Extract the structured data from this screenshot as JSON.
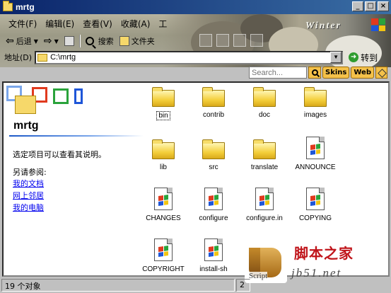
{
  "window": {
    "title": "mrtg"
  },
  "title_buttons": {
    "minimize": "_",
    "maximize": "□",
    "close": "×"
  },
  "banner": {
    "watermark_text": "Winter"
  },
  "menu": [
    "文件(F)",
    "编辑(E)",
    "查看(V)",
    "收藏(A)",
    "工"
  ],
  "toolbar": {
    "back_label": "后退",
    "search_label": "搜索",
    "folders_label": "文件夹"
  },
  "address": {
    "label": "地址(D)",
    "value": "C:\\mrtg",
    "go_label": "转到"
  },
  "search_bar": {
    "placeholder": "Search...",
    "skins_label": "Skins",
    "web_label": "Web"
  },
  "left_pane": {
    "title": "mrtg",
    "description": "选定项目可以查看其说明。",
    "see_also": "另请参阅:",
    "links": [
      "我的文档",
      "网上邻居",
      "我的电脑"
    ]
  },
  "items": [
    {
      "name": "bin",
      "type": "folder",
      "selected": true
    },
    {
      "name": "contrib",
      "type": "folder"
    },
    {
      "name": "doc",
      "type": "folder"
    },
    {
      "name": "images",
      "type": "folder"
    },
    {
      "name": "lib",
      "type": "folder"
    },
    {
      "name": "src",
      "type": "folder"
    },
    {
      "name": "translate",
      "type": "folder"
    },
    {
      "name": "ANNOUNCE",
      "type": "file"
    },
    {
      "name": "CHANGES",
      "type": "file"
    },
    {
      "name": "configure",
      "type": "file"
    },
    {
      "name": "configure.in",
      "type": "file"
    },
    {
      "name": "COPYING",
      "type": "file"
    },
    {
      "name": "COPYRIGHT",
      "type": "file"
    },
    {
      "name": "install-sh",
      "type": "file"
    }
  ],
  "status": {
    "count": "19 个对象",
    "size": "2"
  },
  "watermark": {
    "logo_script": "Script",
    "site_name": "脚本之家",
    "site_url": "jb51.net"
  },
  "colors": {
    "title_bar": "#0a246a",
    "link": "#0000ee",
    "folder": "#f4cf3c",
    "skin_accent": "#f4c14a"
  }
}
